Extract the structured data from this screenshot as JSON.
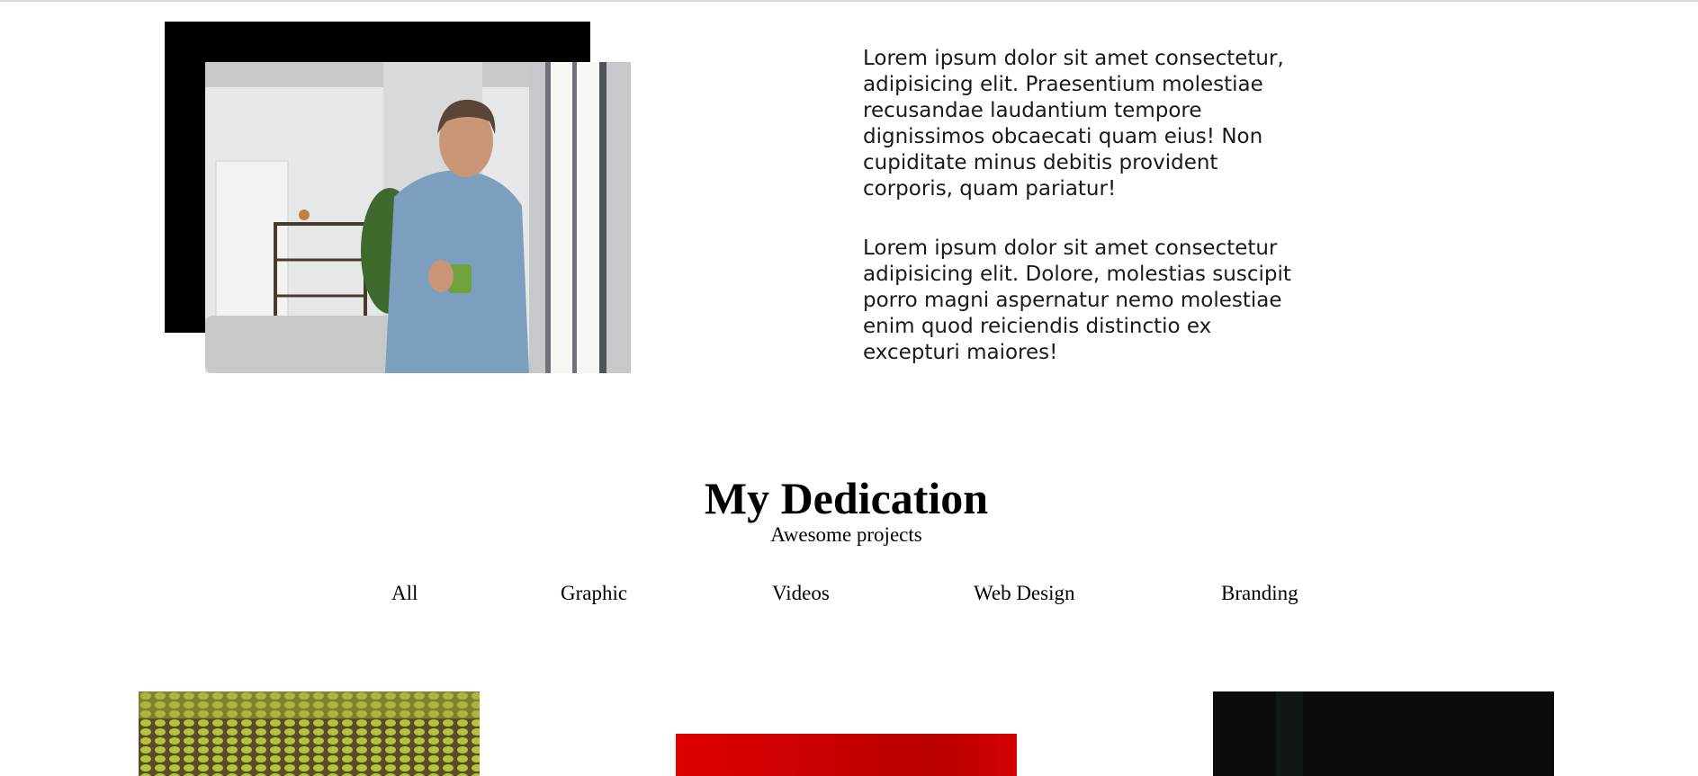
{
  "about": {
    "paragraphs": [
      "Lorem ipsum dolor sit amet consectetur, adipisicing elit. Praesentium molestiae recusandae laudantium tempore dignissimos obcaecati quam eius! Non cupiditate minus debitis provident corporis, quam pariatur!",
      "Lorem ipsum dolor sit amet consectetur adipisicing elit. Dolore, molestias suscipit porro magni aspernatur nemo molestiae enim quod reiciendis distinctio ex excepturi maiores!"
    ]
  },
  "portfolio": {
    "title": "My Dedication",
    "subtitle": "Awesome projects",
    "filters": [
      "All",
      "Graphic",
      "Videos",
      "Web Design",
      "Branding"
    ]
  },
  "colors": {
    "frame": "#000000",
    "card_red": "#d10000",
    "card_dark": "#0a0c0d",
    "card_field": "#8a9a2c"
  }
}
